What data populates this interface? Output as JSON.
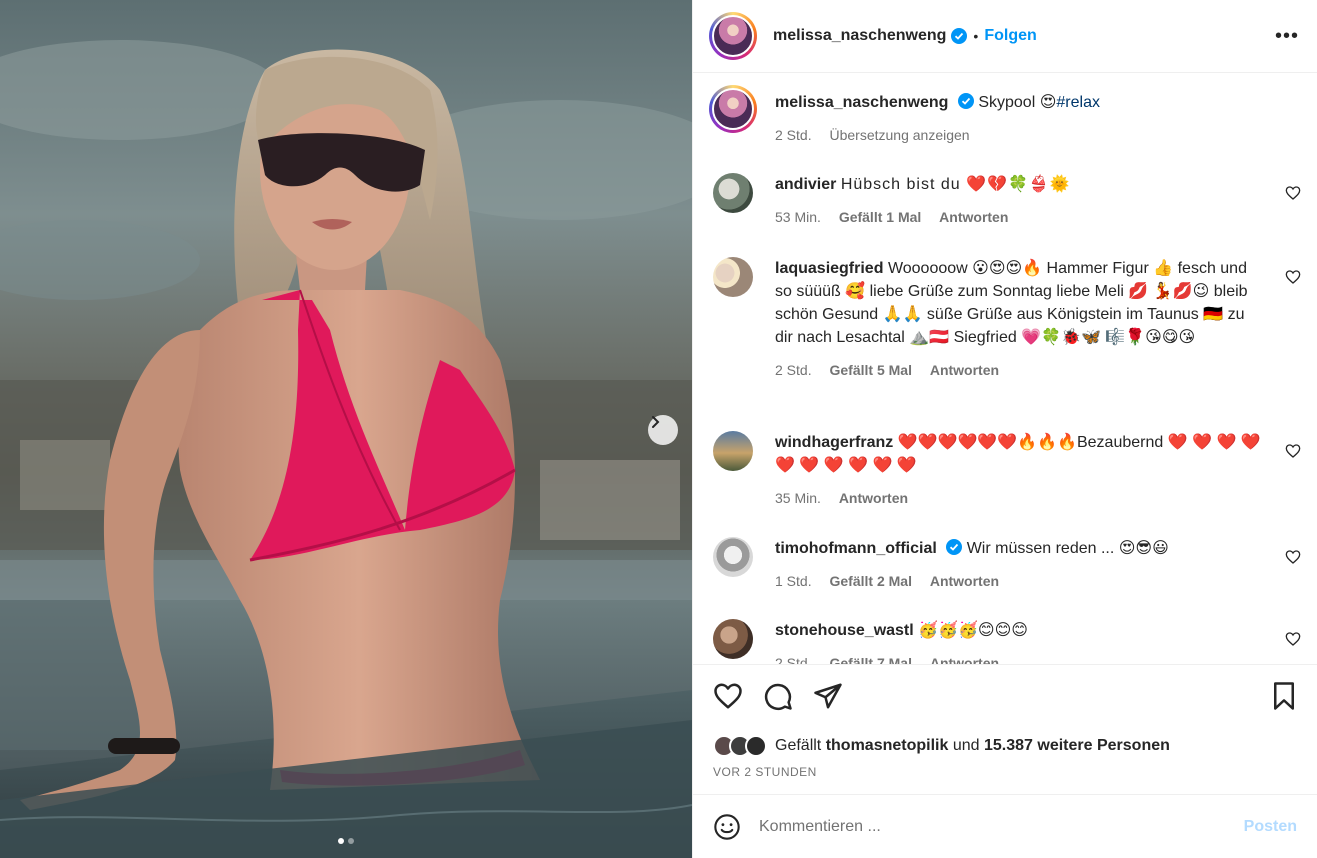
{
  "post": {
    "username": "melissa_naschenweng",
    "separator": "•",
    "follow_label": "Folgen",
    "more_label": "•••",
    "caption_text": "Skypool",
    "caption_emoji": "😍",
    "caption_hashtag": "#relax",
    "caption_age": "2 Std.",
    "translate_label": "Übersetzung anzeigen"
  },
  "comments": [
    {
      "user": "andivier",
      "verified": false,
      "text": "Hübsch bist du ❤️💔🍀👙🌞",
      "age": "53 Min.",
      "likes": "Gefällt 1 Mal",
      "reply": "Antworten"
    },
    {
      "user": "laquasiegfried",
      "verified": false,
      "text": "Woooooow 😮😍😍🔥 Hammer Figur 👍 fesch und so süüüß 🥰 liebe Grüße zum Sonntag liebe Meli 💋 💃💋😉 bleib schön Gesund 🙏🙏 süße Grüße aus Königstein im Taunus 🇩🇪 zu dir nach Lesachtal ⛰️🇦🇹 Siegfried 💗🍀🐞🦋 🎼🌹😘😋😘",
      "age": "2 Std.",
      "likes": "Gefällt 5 Mal",
      "reply": "Antworten"
    },
    {
      "user": "windhagerfranz",
      "verified": false,
      "text": "❤️❤️❤️❤️❤️❤️🔥🔥🔥Bezaubernd ❤️ ❤️ ❤️ ❤️ ❤️ ❤️ ❤️ ❤️ ❤️ ❤️",
      "age": "35 Min.",
      "likes": "",
      "reply": "Antworten"
    },
    {
      "user": "timohofmann_official",
      "verified": true,
      "text": "Wir müssen reden ... 😍😎😃",
      "age": "1 Std.",
      "likes": "Gefällt 2 Mal",
      "reply": "Antworten"
    },
    {
      "user": "stonehouse_wastl",
      "verified": false,
      "text": "🥳🥳🥳😊😊😊",
      "age": "2 Std.",
      "likes": "Gefällt 7 Mal",
      "reply": "Antworten"
    }
  ],
  "likes_summary": {
    "prefix": "Gefällt",
    "user": "thomasnetopilik",
    "middle": "und",
    "count": "15.387 weitere Personen"
  },
  "post_time": "VOR 2 STUNDEN",
  "comment_box": {
    "placeholder": "Kommentieren ...",
    "post_label": "Posten"
  },
  "colors": {
    "link_blue": "#0095f6",
    "hashtag": "#00376b",
    "muted": "#737373",
    "bikini_pink": "#e0195b"
  },
  "carousel": {
    "slides": 2,
    "active": 1
  }
}
